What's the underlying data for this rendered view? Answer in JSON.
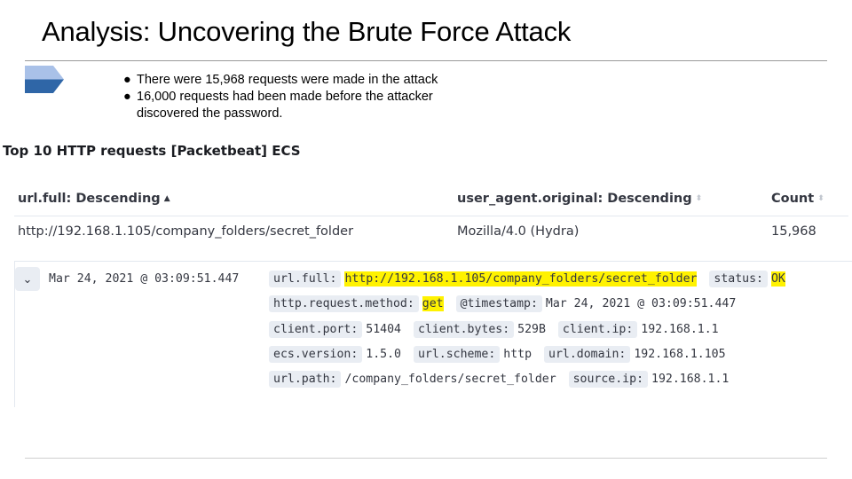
{
  "slide": {
    "title": "Analysis: Uncovering the Brute Force Attack",
    "bullets": [
      "There were 15,968 requests were made in the attack",
      "16,000 requests had been made before the attacker discovered the password."
    ],
    "bullet_glyph": "●"
  },
  "panel": {
    "title": "Top 10 HTTP requests [Packetbeat] ECS",
    "columns": [
      {
        "label": "url.full: Descending",
        "sort": "active"
      },
      {
        "label": "user_agent.original: Descending",
        "sort": "inactive"
      },
      {
        "label": "Count",
        "sort": "inactive"
      }
    ],
    "sort_active_glyph": "▲",
    "sort_inactive_glyph": "⬍",
    "rows": [
      {
        "url": "http://192.168.1.105/company_folders/secret_folder",
        "agent": "Mozilla/4.0 (Hydra)",
        "count": "15,968"
      }
    ]
  },
  "document": {
    "expand_glyph": "⌄",
    "timestamp": "Mar 24, 2021 @ 03:09:51.447",
    "fields": [
      [
        {
          "key": "url.full:",
          "value": "http://192.168.1.105/company_folders/secret_folder",
          "highlight": true
        },
        {
          "key": "status:",
          "value": "OK",
          "highlight": true
        }
      ],
      [
        {
          "key": "http.request.method:",
          "value": "get",
          "highlight": true
        },
        {
          "key": "@timestamp:",
          "value": "Mar 24, 2021 @ 03:09:51.447",
          "highlight": false
        }
      ],
      [
        {
          "key": "client.port:",
          "value": "51404",
          "highlight": false
        },
        {
          "key": "client.bytes:",
          "value": "529B",
          "highlight": false
        },
        {
          "key": "client.ip:",
          "value": "192.168.1.1",
          "highlight": false
        }
      ],
      [
        {
          "key": "ecs.version:",
          "value": "1.5.0",
          "highlight": false
        },
        {
          "key": "url.scheme:",
          "value": "http",
          "highlight": false
        },
        {
          "key": "url.domain:",
          "value": "192.168.1.105",
          "highlight": false
        }
      ],
      [
        {
          "key": "url.path:",
          "value": "/company_folders/secret_folder",
          "highlight": false
        },
        {
          "key": "source.ip:",
          "value": "192.168.1.1",
          "highlight": false
        }
      ]
    ]
  },
  "colors": {
    "arrow_top": "#a9c1e8",
    "arrow_bottom": "#2f66a7",
    "highlight": "#fff200",
    "field_key_bg": "#e9edf3"
  }
}
